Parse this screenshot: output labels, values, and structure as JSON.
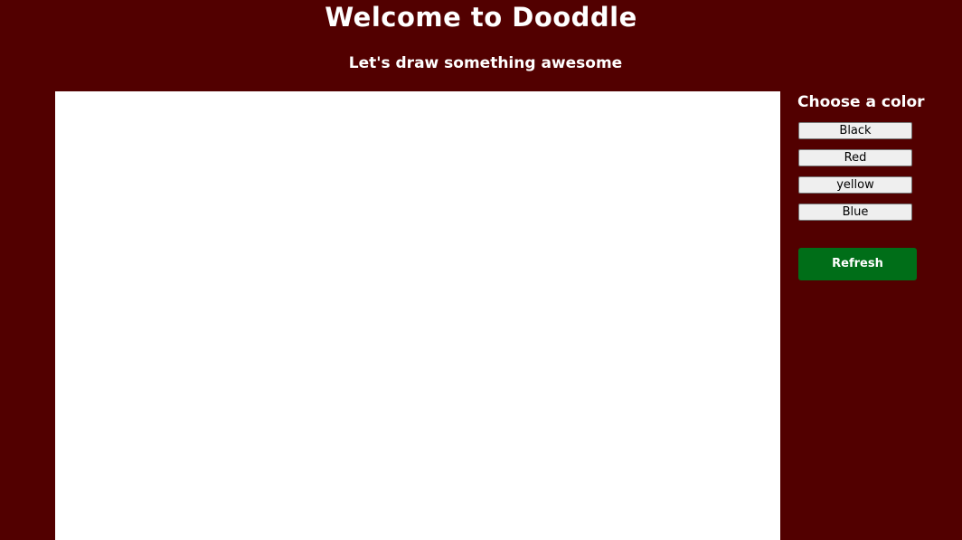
{
  "header": {
    "title": "Welcome to Dooddle",
    "subtitle": "Let's draw something awesome"
  },
  "sidebar": {
    "heading": "Choose a color",
    "colors": [
      {
        "label": "Black"
      },
      {
        "label": "Red"
      },
      {
        "label": "yellow"
      },
      {
        "label": "Blue"
      }
    ],
    "refresh_label": "Refresh"
  },
  "theme": {
    "background": "#520000",
    "canvas": "#ffffff",
    "refresh_button": "#006e18",
    "color_button": "#efefef"
  }
}
